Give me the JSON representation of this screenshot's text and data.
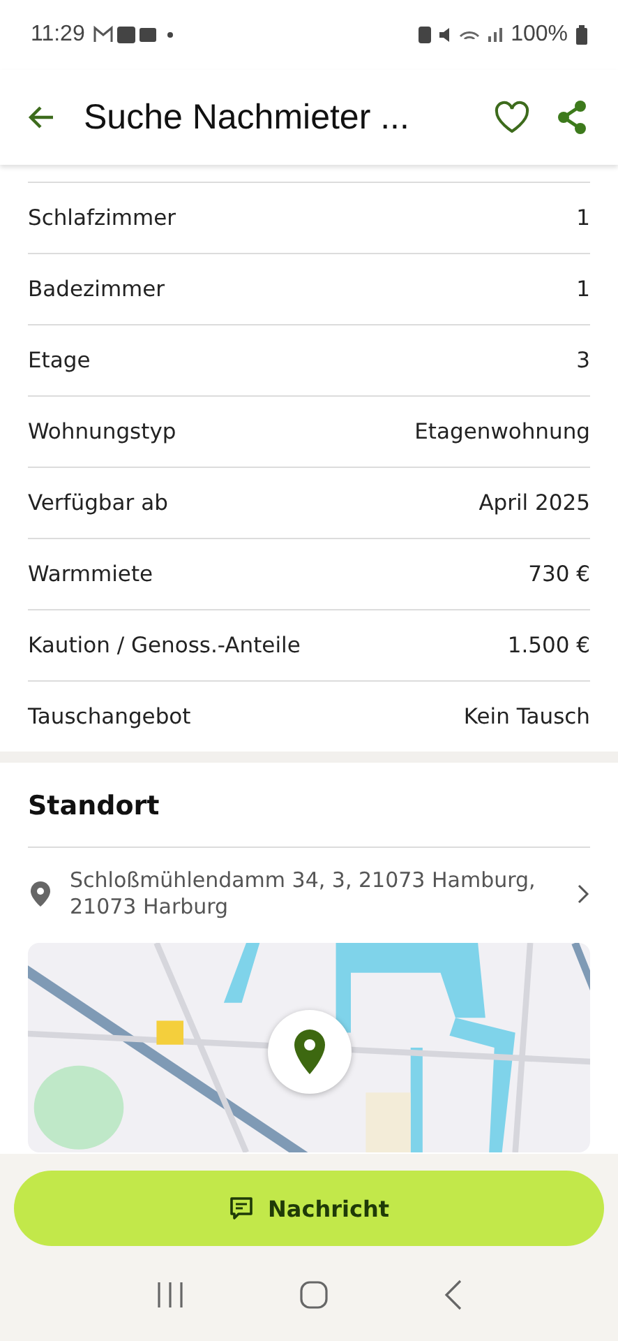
{
  "status_bar": {
    "time": "11:29",
    "battery": "100%"
  },
  "app_bar": {
    "title": "Suche Nachmieter ..."
  },
  "details": [
    {
      "label": "Schlafzimmer",
      "value": "1"
    },
    {
      "label": "Badezimmer",
      "value": "1"
    },
    {
      "label": "Etage",
      "value": "3"
    },
    {
      "label": "Wohnungstyp",
      "value": "Etagenwohnung"
    },
    {
      "label": "Verfügbar ab",
      "value": "April 2025"
    },
    {
      "label": "Warmmiete",
      "value": "730 €"
    },
    {
      "label": "Kaution / Genoss.-Anteile",
      "value": "1.500 €"
    },
    {
      "label": "Tauschangebot",
      "value": "Kein Tausch"
    }
  ],
  "location": {
    "heading": "Standort",
    "address": "Schloßmühlendamm 34, 3, 21073 Hamburg, 21073 Harburg"
  },
  "message_button": {
    "label": "Nachricht"
  }
}
